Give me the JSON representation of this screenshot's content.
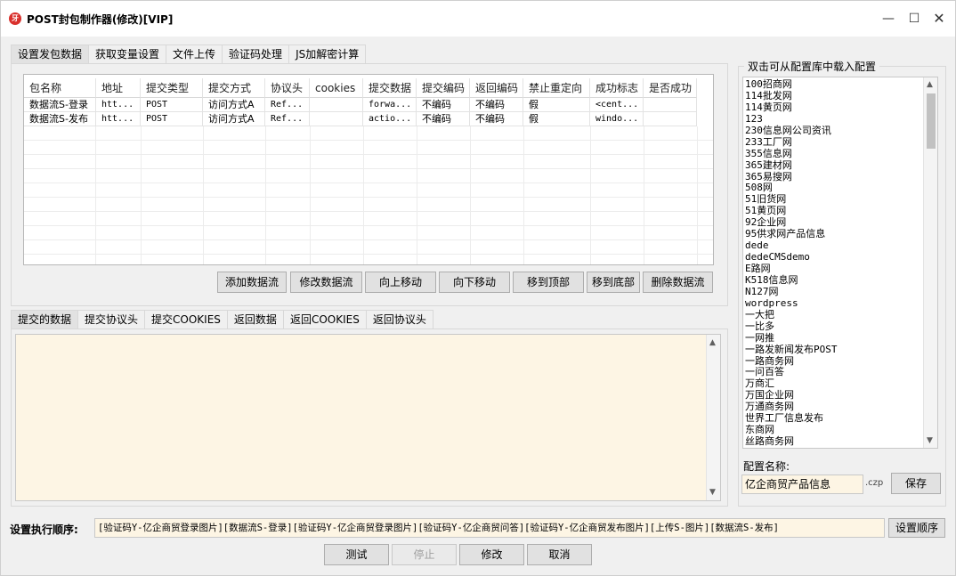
{
  "window": {
    "title": "POST封包制作器(修改)[VIP]",
    "icon_glyph": "牙",
    "minimize_glyph": "—",
    "maximize_glyph": "☐",
    "close_glyph": "✕"
  },
  "top_tabs": [
    "设置发包数据",
    "获取变量设置",
    "文件上传",
    "验证码处理",
    "JS加解密计算"
  ],
  "table": {
    "columns": [
      "包名称",
      "地址",
      "提交类型",
      "提交方式",
      "协议头",
      "cookies",
      "提交数据",
      "提交编码",
      "返回编码",
      "禁止重定向",
      "成功标志",
      "是否成功"
    ],
    "rows": [
      [
        "数据流S-登录",
        "htt...",
        "POST",
        "访问方式A",
        "Ref...",
        "",
        "forwa...",
        "不编码",
        "不编码",
        "假",
        "<cent...",
        ""
      ],
      [
        "数据流S-发布",
        "htt...",
        "POST",
        "访问方式A",
        "Ref...",
        "",
        "actio...",
        "不编码",
        "不编码",
        "假",
        "windo...",
        ""
      ]
    ]
  },
  "table_buttons": [
    "添加数据流",
    "修改数据流",
    "向上移动",
    "向下移动",
    "移到顶部",
    "移到底部",
    "删除数据流"
  ],
  "bottom_tabs": [
    "提交的数据",
    "提交协议头",
    "提交COOKIES",
    "返回数据",
    "返回COOKIES",
    "返回协议头"
  ],
  "config_panel": {
    "title": "双击可从配置库中载入配置",
    "items": [
      "100招商网",
      "114批发网",
      "114黄页网",
      "123",
      "230信息网公司资讯",
      "233工厂网",
      "355信息网",
      "365建材网",
      "365易搜网",
      "508网",
      "51旧货网",
      "51黄页网",
      "92企业网",
      "95供求网产品信息",
      "dede",
      "dedeCMSdemo",
      "E路网",
      "K518信息网",
      "N127网",
      "wordpress",
      "一大把",
      "一比多",
      "一网推",
      "一路发新闻发布POST",
      "一路商务网",
      "一问百答",
      "万商汇",
      "万国企业网",
      "万通商务网",
      "世界工厂信息发布",
      "东商网",
      "丝路商务网"
    ],
    "name_label": "配置名称:",
    "name_value": "亿企商贸产品信息",
    "ext": ".czp",
    "save_label": "保存"
  },
  "order": {
    "label": "设置执行顺序:",
    "value": "[验证码Y-亿企商贸登录图片][数据流S-登录][验证码Y-亿企商贸登录图片][验证码Y-亿企商贸问答][验证码Y-亿企商贸发布图片][上传S-图片][数据流S-发布]",
    "button_label": "设置顺序"
  },
  "actions": {
    "test": "测试",
    "stop": "停止",
    "modify": "修改",
    "cancel": "取消"
  },
  "scroll_up_glyph": "▲",
  "scroll_down_glyph": "▼"
}
